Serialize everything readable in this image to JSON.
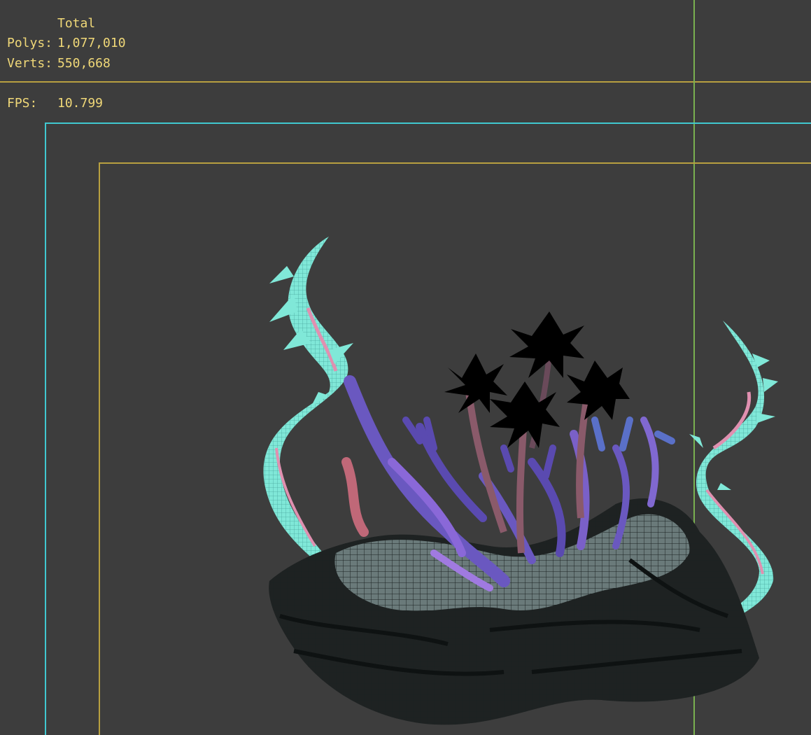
{
  "viewport": {
    "stats": {
      "header": "Total",
      "polys_label": "Polys:",
      "polys_value": "1,077,010",
      "verts_label": "Verts:",
      "verts_value": "550,668",
      "fps_label": "FPS:",
      "fps_value": "10.799"
    },
    "colors": {
      "background": "#3d3d3d",
      "stats_text": "#f0d878",
      "safe_frame_yellow": "#b8a040",
      "safe_frame_cyan": "#40c8d0",
      "grid_line_green": "#7ab050",
      "seaweed": "#80e8d8",
      "seaweed_core": "#e090b0",
      "coral": "#7a5cc8",
      "rock": "#5a6868"
    },
    "icons": [
      "coral-reef-model"
    ]
  }
}
